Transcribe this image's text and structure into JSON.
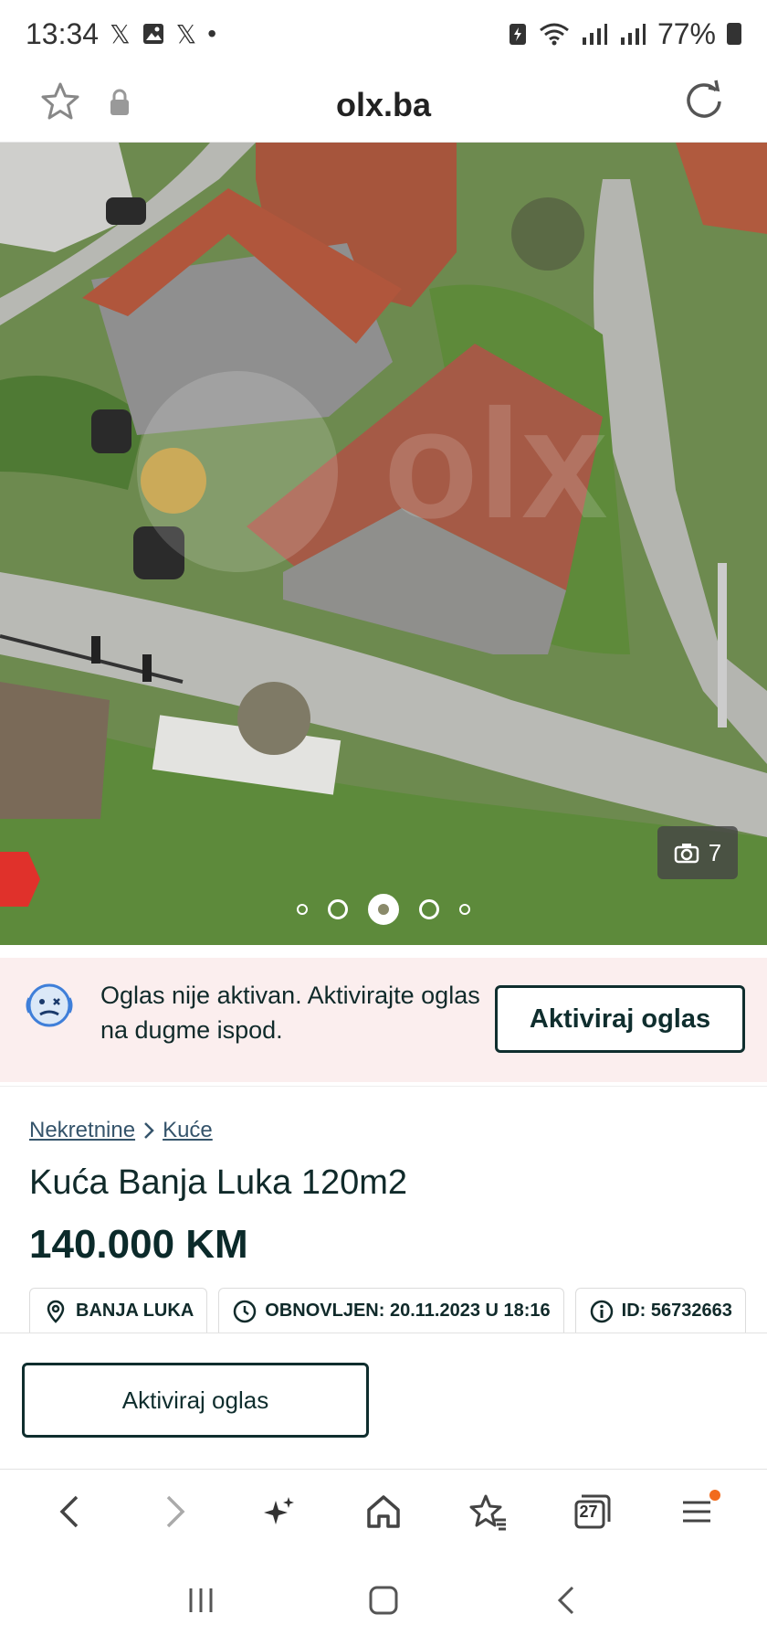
{
  "status_bar": {
    "time": "13:34",
    "battery": "77%",
    "notification_icons": [
      "x-icon",
      "image-icon",
      "x-icon",
      "dot"
    ]
  },
  "url_bar": {
    "domain": "olx.ba"
  },
  "gallery": {
    "photo_count": "7",
    "watermark": "olx",
    "dots_total": 5,
    "active_dot": 3
  },
  "notice": {
    "text": "Oglas nije aktivan. Aktivirajte oglas na dugme ispod.",
    "button_label": "Aktiviraj oglas"
  },
  "listing": {
    "breadcrumb": [
      "Nekretnine",
      "Kuće"
    ],
    "title": "Kuća Banja Luka 120m2",
    "price": "140.000 KM",
    "location": "BANJA LUKA",
    "updated": "OBNOVLJEN: 20.11.2023 U 18:16",
    "id": "ID: 56732663"
  },
  "action_bar": {
    "button_label": "Aktiviraj oglas"
  },
  "browser_toolbar": {
    "tabs_count": "27",
    "items": [
      "back-icon",
      "forward-icon",
      "sparkle-icon",
      "home-icon",
      "bookmarks-icon",
      "tabs-icon",
      "menu-icon"
    ]
  },
  "colors": {
    "brand_dark": "#0f2e2e",
    "notice_bg": "#fbeeee",
    "notification_dot": "#f26b1d"
  }
}
